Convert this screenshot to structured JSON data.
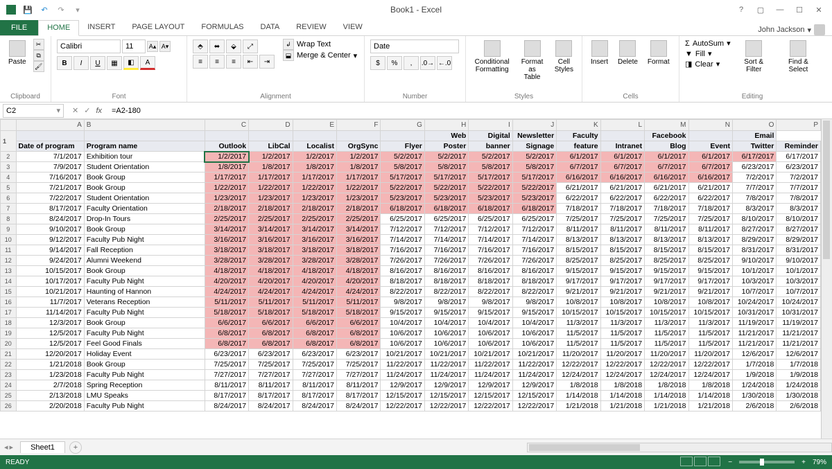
{
  "title": "Book1 - Excel",
  "user": "John Jackson",
  "tabs": [
    "FILE",
    "HOME",
    "INSERT",
    "PAGE LAYOUT",
    "FORMULAS",
    "DATA",
    "REVIEW",
    "VIEW"
  ],
  "active_tab": "HOME",
  "ribbon": {
    "clipboard": {
      "label": "Clipboard",
      "paste": "Paste"
    },
    "font": {
      "label": "Font",
      "name": "Calibri",
      "size": "11"
    },
    "alignment": {
      "label": "Alignment",
      "wrap": "Wrap Text",
      "merge": "Merge & Center"
    },
    "number": {
      "label": "Number",
      "format": "Date"
    },
    "styles": {
      "label": "Styles",
      "cond": "Conditional Formatting",
      "table": "Format as Table",
      "cell": "Cell Styles"
    },
    "cells": {
      "label": "Cells",
      "insert": "Insert",
      "delete": "Delete",
      "format": "Format"
    },
    "editing": {
      "label": "Editing",
      "autosum": "AutoSum",
      "fill": "Fill",
      "clear": "Clear",
      "sort": "Sort & Filter",
      "find": "Find & Select"
    }
  },
  "name_box": "C2",
  "formula": "=A2-180",
  "col_letters": [
    "A",
    "B",
    "C",
    "D",
    "E",
    "F",
    "G",
    "H",
    "I",
    "J",
    "K",
    "L",
    "M",
    "N",
    "O",
    "P"
  ],
  "headers_top": [
    "",
    "",
    "",
    "",
    "",
    "",
    "",
    "Web",
    "Digital",
    "Newsletter",
    "Faculty",
    "",
    "Facebook",
    "",
    "Email"
  ],
  "headers_bot": [
    "Date of program",
    "Program name",
    "Outlook",
    "LibCal",
    "Localist",
    "OrgSync",
    "Flyer",
    "Poster",
    "banner",
    "Signage",
    "feature",
    "Intranet",
    "Blog",
    "Event",
    "Twitter",
    "Reminder"
  ],
  "rows": [
    {
      "n": 2,
      "pinkEnd": 14,
      "cells": [
        "7/1/2017",
        "Exhibition tour",
        "1/2/2017",
        "1/2/2017",
        "1/2/2017",
        "1/2/2017",
        "5/2/2017",
        "5/2/2017",
        "5/2/2017",
        "5/2/2017",
        "6/1/2017",
        "6/1/2017",
        "6/1/2017",
        "6/1/2017",
        "6/17/2017",
        "6/17/2017"
      ]
    },
    {
      "n": 3,
      "pinkEnd": 13,
      "cells": [
        "7/9/2017",
        "Student Orientation",
        "1/8/2017",
        "1/8/2017",
        "1/8/2017",
        "1/8/2017",
        "5/8/2017",
        "5/8/2017",
        "5/8/2017",
        "5/8/2017",
        "6/7/2017",
        "6/7/2017",
        "6/7/2017",
        "6/7/2017",
        "6/23/2017",
        "6/23/2017"
      ]
    },
    {
      "n": 4,
      "pinkEnd": 13,
      "cells": [
        "7/16/2017",
        "Book Group",
        "1/17/2017",
        "1/17/2017",
        "1/17/2017",
        "1/17/2017",
        "5/17/2017",
        "5/17/2017",
        "5/17/2017",
        "5/17/2017",
        "6/16/2017",
        "6/16/2017",
        "6/16/2017",
        "6/16/2017",
        "7/2/2017",
        "7/2/2017"
      ]
    },
    {
      "n": 5,
      "pinkEnd": 9,
      "cells": [
        "7/21/2017",
        "Book Group",
        "1/22/2017",
        "1/22/2017",
        "1/22/2017",
        "1/22/2017",
        "5/22/2017",
        "5/22/2017",
        "5/22/2017",
        "5/22/2017",
        "6/21/2017",
        "6/21/2017",
        "6/21/2017",
        "6/21/2017",
        "7/7/2017",
        "7/7/2017"
      ]
    },
    {
      "n": 6,
      "pinkEnd": 9,
      "cells": [
        "7/22/2017",
        "Student Orientation",
        "1/23/2017",
        "1/23/2017",
        "1/23/2017",
        "1/23/2017",
        "5/23/2017",
        "5/23/2017",
        "5/23/2017",
        "5/23/2017",
        "6/22/2017",
        "6/22/2017",
        "6/22/2017",
        "6/22/2017",
        "7/8/2017",
        "7/8/2017"
      ]
    },
    {
      "n": 7,
      "pinkEnd": 9,
      "cells": [
        "8/17/2017",
        "Faculty Orientation",
        "2/18/2017",
        "2/18/2017",
        "2/18/2017",
        "2/18/2017",
        "6/18/2017",
        "6/18/2017",
        "6/18/2017",
        "6/18/2017",
        "7/18/2017",
        "7/18/2017",
        "7/18/2017",
        "7/18/2017",
        "8/3/2017",
        "8/3/2017"
      ]
    },
    {
      "n": 8,
      "pinkEnd": 5,
      "cells": [
        "8/24/2017",
        "Drop-In Tours",
        "2/25/2017",
        "2/25/2017",
        "2/25/2017",
        "2/25/2017",
        "6/25/2017",
        "6/25/2017",
        "6/25/2017",
        "6/25/2017",
        "7/25/2017",
        "7/25/2017",
        "7/25/2017",
        "7/25/2017",
        "8/10/2017",
        "8/10/2017"
      ]
    },
    {
      "n": 9,
      "pinkEnd": 5,
      "cells": [
        "9/10/2017",
        "Book Group",
        "3/14/2017",
        "3/14/2017",
        "3/14/2017",
        "3/14/2017",
        "7/12/2017",
        "7/12/2017",
        "7/12/2017",
        "7/12/2017",
        "8/11/2017",
        "8/11/2017",
        "8/11/2017",
        "8/11/2017",
        "8/27/2017",
        "8/27/2017"
      ]
    },
    {
      "n": 10,
      "pinkEnd": 5,
      "cells": [
        "9/12/2017",
        "Faculty Pub Night",
        "3/16/2017",
        "3/16/2017",
        "3/16/2017",
        "3/16/2017",
        "7/14/2017",
        "7/14/2017",
        "7/14/2017",
        "7/14/2017",
        "8/13/2017",
        "8/13/2017",
        "8/13/2017",
        "8/13/2017",
        "8/29/2017",
        "8/29/2017"
      ]
    },
    {
      "n": 11,
      "pinkEnd": 5,
      "cells": [
        "9/14/2017",
        "Fall Reception",
        "3/18/2017",
        "3/18/2017",
        "3/18/2017",
        "3/18/2017",
        "7/16/2017",
        "7/16/2017",
        "7/16/2017",
        "7/16/2017",
        "8/15/2017",
        "8/15/2017",
        "8/15/2017",
        "8/15/2017",
        "8/31/2017",
        "8/31/2017"
      ]
    },
    {
      "n": 12,
      "pinkEnd": 5,
      "cells": [
        "9/24/2017",
        "Alumni Weekend",
        "3/28/2017",
        "3/28/2017",
        "3/28/2017",
        "3/28/2017",
        "7/26/2017",
        "7/26/2017",
        "7/26/2017",
        "7/26/2017",
        "8/25/2017",
        "8/25/2017",
        "8/25/2017",
        "8/25/2017",
        "9/10/2017",
        "9/10/2017"
      ]
    },
    {
      "n": 13,
      "pinkEnd": 5,
      "cells": [
        "10/15/2017",
        "Book Group",
        "4/18/2017",
        "4/18/2017",
        "4/18/2017",
        "4/18/2017",
        "8/16/2017",
        "8/16/2017",
        "8/16/2017",
        "8/16/2017",
        "9/15/2017",
        "9/15/2017",
        "9/15/2017",
        "9/15/2017",
        "10/1/2017",
        "10/1/2017"
      ]
    },
    {
      "n": 14,
      "pinkEnd": 5,
      "cells": [
        "10/17/2017",
        "Faculty Pub Night",
        "4/20/2017",
        "4/20/2017",
        "4/20/2017",
        "4/20/2017",
        "8/18/2017",
        "8/18/2017",
        "8/18/2017",
        "8/18/2017",
        "9/17/2017",
        "9/17/2017",
        "9/17/2017",
        "9/17/2017",
        "10/3/2017",
        "10/3/2017"
      ]
    },
    {
      "n": 15,
      "pinkEnd": 5,
      "cells": [
        "10/21/2017",
        "Haunting of Hannon",
        "4/24/2017",
        "4/24/2017",
        "4/24/2017",
        "4/24/2017",
        "8/22/2017",
        "8/22/2017",
        "8/22/2017",
        "8/22/2017",
        "9/21/2017",
        "9/21/2017",
        "9/21/2017",
        "9/21/2017",
        "10/7/2017",
        "10/7/2017"
      ]
    },
    {
      "n": 16,
      "pinkEnd": 5,
      "cells": [
        "11/7/2017",
        "Veterans Reception",
        "5/11/2017",
        "5/11/2017",
        "5/11/2017",
        "5/11/2017",
        "9/8/2017",
        "9/8/2017",
        "9/8/2017",
        "9/8/2017",
        "10/8/2017",
        "10/8/2017",
        "10/8/2017",
        "10/8/2017",
        "10/24/2017",
        "10/24/2017"
      ]
    },
    {
      "n": 17,
      "pinkEnd": 5,
      "cells": [
        "11/14/2017",
        "Faculty Pub Night",
        "5/18/2017",
        "5/18/2017",
        "5/18/2017",
        "5/18/2017",
        "9/15/2017",
        "9/15/2017",
        "9/15/2017",
        "9/15/2017",
        "10/15/2017",
        "10/15/2017",
        "10/15/2017",
        "10/15/2017",
        "10/31/2017",
        "10/31/2017"
      ]
    },
    {
      "n": 18,
      "pinkEnd": 5,
      "cells": [
        "12/3/2017",
        "Book Group",
        "6/6/2017",
        "6/6/2017",
        "6/6/2017",
        "6/6/2017",
        "10/4/2017",
        "10/4/2017",
        "10/4/2017",
        "10/4/2017",
        "11/3/2017",
        "11/3/2017",
        "11/3/2017",
        "11/3/2017",
        "11/19/2017",
        "11/19/2017"
      ]
    },
    {
      "n": 19,
      "pinkEnd": 5,
      "cells": [
        "12/5/2017",
        "Faculty Pub Night",
        "6/8/2017",
        "6/8/2017",
        "6/8/2017",
        "6/8/2017",
        "10/6/2017",
        "10/6/2017",
        "10/6/2017",
        "10/6/2017",
        "11/5/2017",
        "11/5/2017",
        "11/5/2017",
        "11/5/2017",
        "11/21/2017",
        "11/21/2017"
      ]
    },
    {
      "n": 20,
      "pinkEnd": 5,
      "cells": [
        "12/5/2017",
        "Feel Good Finals",
        "6/8/2017",
        "6/8/2017",
        "6/8/2017",
        "6/8/2017",
        "10/6/2017",
        "10/6/2017",
        "10/6/2017",
        "10/6/2017",
        "11/5/2017",
        "11/5/2017",
        "11/5/2017",
        "11/5/2017",
        "11/21/2017",
        "11/21/2017"
      ]
    },
    {
      "n": 21,
      "pinkEnd": 0,
      "cells": [
        "12/20/2017",
        "Holiday Event",
        "6/23/2017",
        "6/23/2017",
        "6/23/2017",
        "6/23/2017",
        "10/21/2017",
        "10/21/2017",
        "10/21/2017",
        "10/21/2017",
        "11/20/2017",
        "11/20/2017",
        "11/20/2017",
        "11/20/2017",
        "12/6/2017",
        "12/6/2017"
      ]
    },
    {
      "n": 22,
      "pinkEnd": 0,
      "cells": [
        "1/21/2018",
        "Book Group",
        "7/25/2017",
        "7/25/2017",
        "7/25/2017",
        "7/25/2017",
        "11/22/2017",
        "11/22/2017",
        "11/22/2017",
        "11/22/2017",
        "12/22/2017",
        "12/22/2017",
        "12/22/2017",
        "12/22/2017",
        "1/7/2018",
        "1/7/2018"
      ]
    },
    {
      "n": 23,
      "pinkEnd": 0,
      "cells": [
        "1/23/2018",
        "Faculty Pub Night",
        "7/27/2017",
        "7/27/2017",
        "7/27/2017",
        "7/27/2017",
        "11/24/2017",
        "11/24/2017",
        "11/24/2017",
        "11/24/2017",
        "12/24/2017",
        "12/24/2017",
        "12/24/2017",
        "12/24/2017",
        "1/9/2018",
        "1/9/2018"
      ]
    },
    {
      "n": 24,
      "pinkEnd": 0,
      "cells": [
        "2/7/2018",
        "Spring Reception",
        "8/11/2017",
        "8/11/2017",
        "8/11/2017",
        "8/11/2017",
        "12/9/2017",
        "12/9/2017",
        "12/9/2017",
        "12/9/2017",
        "1/8/2018",
        "1/8/2018",
        "1/8/2018",
        "1/8/2018",
        "1/24/2018",
        "1/24/2018"
      ]
    },
    {
      "n": 25,
      "pinkEnd": 0,
      "cells": [
        "2/13/2018",
        "LMU Speaks",
        "8/17/2017",
        "8/17/2017",
        "8/17/2017",
        "8/17/2017",
        "12/15/2017",
        "12/15/2017",
        "12/15/2017",
        "12/15/2017",
        "1/14/2018",
        "1/14/2018",
        "1/14/2018",
        "1/14/2018",
        "1/30/2018",
        "1/30/2018"
      ]
    },
    {
      "n": 26,
      "pinkEnd": 0,
      "cells": [
        "2/20/2018",
        "Faculty Pub Night",
        "8/24/2017",
        "8/24/2017",
        "8/24/2017",
        "8/24/2017",
        "12/22/2017",
        "12/22/2017",
        "12/22/2017",
        "12/22/2017",
        "1/21/2018",
        "1/21/2018",
        "1/21/2018",
        "1/21/2018",
        "2/6/2018",
        "2/6/2018"
      ]
    }
  ],
  "sheet_tab": "Sheet1",
  "status": "READY",
  "zoom": "79%"
}
